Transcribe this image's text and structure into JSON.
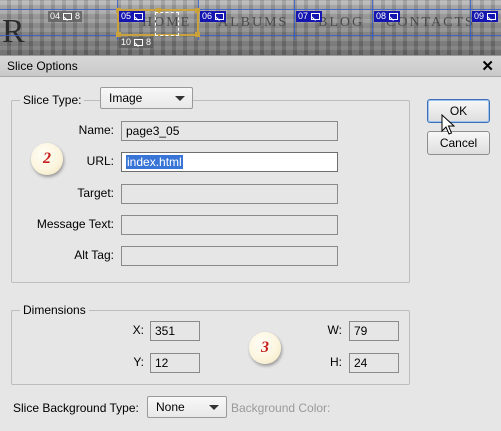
{
  "background": {
    "logo_letter": "R",
    "nav": [
      "HOME",
      "ALBUMS",
      "BLOG",
      "CONTACTS"
    ],
    "slice_tags": [
      {
        "num": "04",
        "extra": "8"
      },
      {
        "num": "05",
        "extra": ""
      },
      {
        "num": "06",
        "extra": ""
      },
      {
        "num": "07",
        "extra": ""
      },
      {
        "num": "08",
        "extra": ""
      },
      {
        "num": "09",
        "extra": ""
      },
      {
        "num": "10",
        "extra": "8"
      }
    ]
  },
  "dialog": {
    "title": "Slice Options",
    "close_symbol": "✕",
    "slice_type_group": {
      "legend": "Slice Type:",
      "slice_type_value": "Image",
      "fields": {
        "name_label": "Name:",
        "name_value": "page3_05",
        "url_label": "URL:",
        "url_value": "index.html",
        "target_label": "Target:",
        "target_value": "",
        "message_label": "Message Text:",
        "message_value": "",
        "alt_label": "Alt Tag:",
        "alt_value": ""
      }
    },
    "dimensions_group": {
      "legend": "Dimensions",
      "x_label": "X:",
      "x_value": "351",
      "y_label": "Y:",
      "y_value": "12",
      "w_label": "W:",
      "w_value": "79",
      "h_label": "H:",
      "h_value": "24"
    },
    "buttons": {
      "ok": "OK",
      "cancel": "Cancel"
    },
    "background_type_label": "Slice Background Type:",
    "background_type_value": "None",
    "background_color_label": "Background Color:",
    "badges": [
      "2",
      "3"
    ],
    "colors": {
      "badge_text": "#c81e1e",
      "selection": "#3875d7",
      "slice_tag": "#1515b0",
      "selected_slice_border": "#c9a13d"
    }
  }
}
